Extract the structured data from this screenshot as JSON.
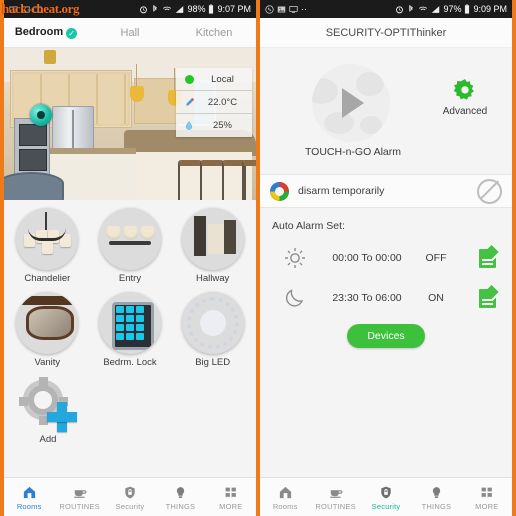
{
  "watermark": "hack-cheat.org",
  "left": {
    "status_bar": {
      "icons": [
        "screenshot-icon",
        "screenshot-icon",
        "screenshot-icon"
      ],
      "right_icons": [
        "alarm-icon",
        "bluetooth-icon",
        "wifi-icon",
        "signal-icon"
      ],
      "battery": "98%",
      "time": "9:07 PM"
    },
    "room_tabs": [
      {
        "label": "Bedroom",
        "active": true,
        "badge": "✓"
      },
      {
        "label": "Hall",
        "active": false
      },
      {
        "label": "Kitchen",
        "active": false
      }
    ],
    "info_card": [
      {
        "icon": "green-dot-icon",
        "value": "Local"
      },
      {
        "icon": "thermometer-icon",
        "value": "22.0°C"
      },
      {
        "icon": "humidity-drop-icon",
        "value": "25%"
      }
    ],
    "devices": [
      {
        "label": "Chandelier",
        "icon": "chandelier-photo"
      },
      {
        "label": "Entry",
        "icon": "entry-light-photo"
      },
      {
        "label": "Hallway",
        "icon": "hallway-photo"
      },
      {
        "label": "Vanity",
        "icon": "vanity-photo"
      },
      {
        "label": "Bedrm. Lock",
        "icon": "keypad-lock-photo"
      },
      {
        "label": "Big LED",
        "icon": "big-led-photo"
      }
    ],
    "add_tile": {
      "label": "Add",
      "icon": "gear-plus-icon"
    },
    "bottom_nav": [
      {
        "label": "Rooms",
        "icon": "home-icon",
        "active": true
      },
      {
        "label": "ROUTINES",
        "icon": "coffee-cup-icon",
        "active": false
      },
      {
        "label": "Security",
        "icon": "shield-lock-icon",
        "active": false
      },
      {
        "label": "THINGS",
        "icon": "bulb-icon",
        "active": false
      },
      {
        "label": "MORE",
        "icon": "grid-icon",
        "active": false
      }
    ]
  },
  "right": {
    "status_bar": {
      "left_icons": [
        "whatsapp-icon",
        "image-icon",
        "monitor-icon",
        "more-dots-icon"
      ],
      "right_icons": [
        "alarm-icon",
        "bluetooth-icon",
        "wifi-icon",
        "signal-icon"
      ],
      "battery": "97%",
      "time": "9:09 PM"
    },
    "title": "SECURITY-OPTIThinker",
    "alarm": {
      "play_label": "TOUCH-n-GO Alarm",
      "play_icon": "play-icon",
      "advanced_label": "Advanced",
      "advanced_icon": "green-gear-icon"
    },
    "disarm": {
      "label": "disarm temporarily",
      "icon": "color-wheel-icon",
      "action_icon": "block-icon"
    },
    "auto_alarm_label": "Auto Alarm Set:",
    "schedules": [
      {
        "icon": "sun-icon",
        "time": "00:00 To 00:00",
        "state": "OFF",
        "edit_icon": "edit-icon"
      },
      {
        "icon": "moon-icon",
        "time": "23:30 To 06:00",
        "state": "ON",
        "edit_icon": "edit-icon"
      }
    ],
    "devices_button": "Devices",
    "bottom_nav": [
      {
        "label": "Rooms",
        "icon": "home-icon",
        "active": false
      },
      {
        "label": "ROUTINES",
        "icon": "coffee-cup-icon",
        "active": false
      },
      {
        "label": "Security",
        "icon": "shield-lock-icon",
        "active": true
      },
      {
        "label": "THINGS",
        "icon": "bulb-icon",
        "active": false
      },
      {
        "label": "MORE",
        "icon": "grid-icon",
        "active": false
      }
    ]
  }
}
